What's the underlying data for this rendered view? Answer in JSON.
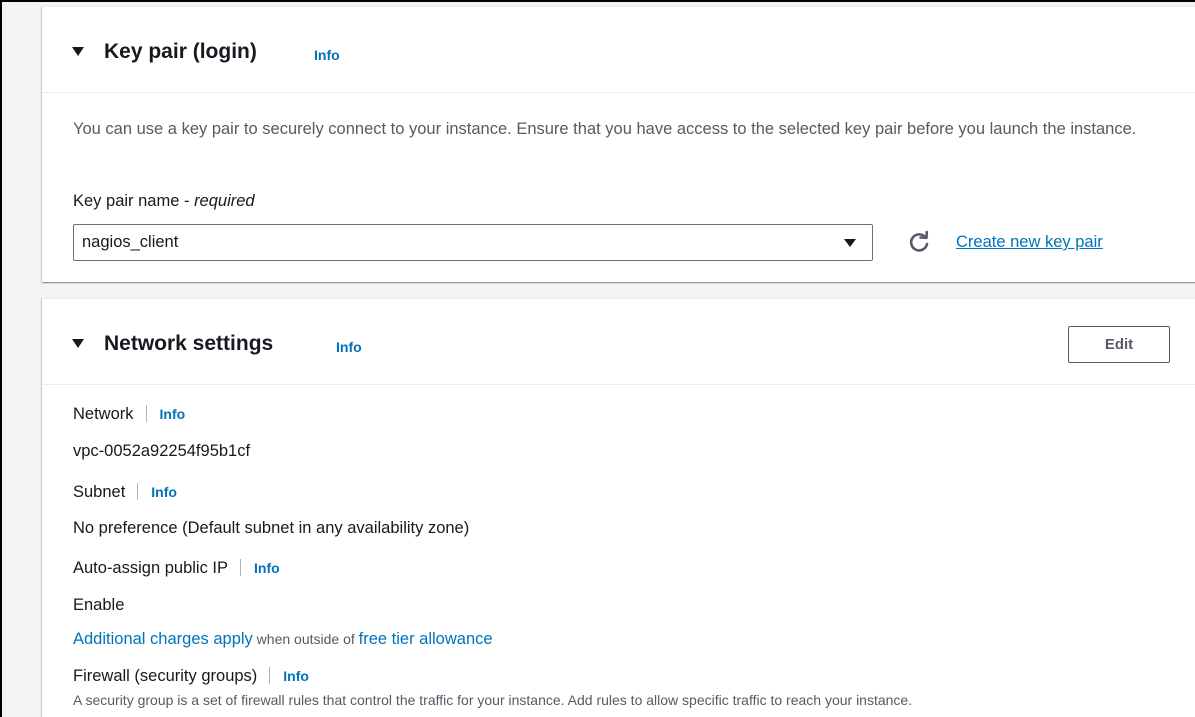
{
  "key_pair": {
    "title": "Key pair (login)",
    "info": "Info",
    "description": "You can use a key pair to securely connect to your instance. Ensure that you have access to the selected key pair before you launch the instance.",
    "field_label": "Key pair name - ",
    "field_required": "required",
    "selected_value": "nagios_client",
    "create_link": "Create new key pair"
  },
  "network": {
    "title": "Network settings",
    "info": "Info",
    "edit_label": "Edit",
    "network_label": "Network",
    "network_info": "Info",
    "network_value": "vpc-0052a92254f95b1cf",
    "subnet_label": "Subnet",
    "subnet_info": "Info",
    "subnet_value": "No preference (Default subnet in any availability zone)",
    "public_ip_label": "Auto-assign public IP",
    "public_ip_info": "Info",
    "public_ip_value": "Enable",
    "charges_link": "Additional charges apply",
    "charges_middle": " when outside of ",
    "charges_link2": "free tier allowance",
    "firewall_label": "Firewall (security groups)",
    "firewall_info": "Info",
    "firewall_description": "A security group is a set of firewall rules that control the traffic for your instance. Add rules to allow specific traffic to reach your instance."
  },
  "colors": {
    "link": "#0073bb",
    "text": "#16191f",
    "secondary_text": "#545b64",
    "page_background": "#f2f3f3"
  }
}
